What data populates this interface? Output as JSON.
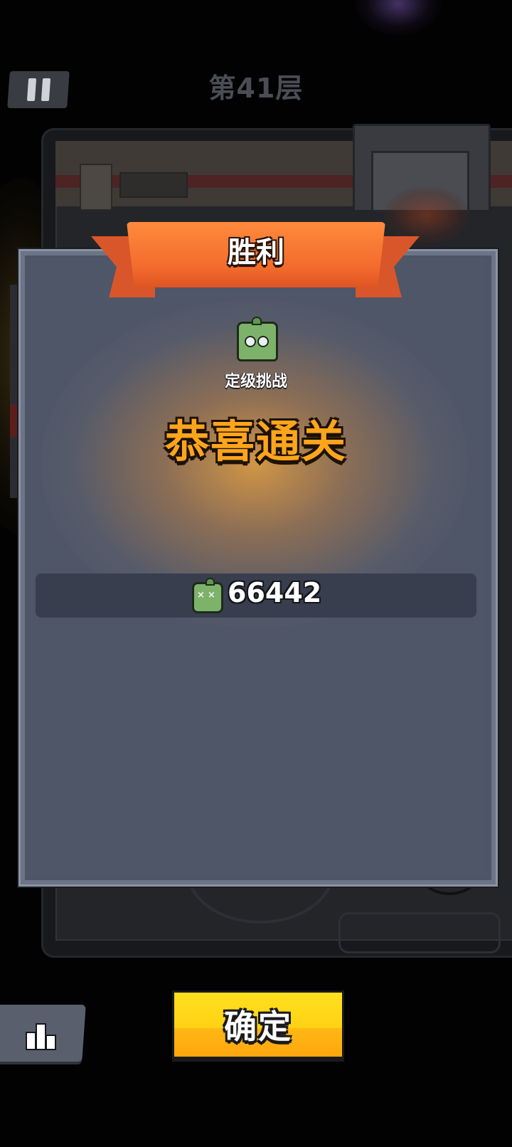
{
  "header": {
    "floor_title": "第41层"
  },
  "result": {
    "ribbon_title": "胜利",
    "challenge_label": "定级挑战",
    "congrats_text": "恭喜通关",
    "reward_value": "66442"
  },
  "footer": {
    "confirm_label": "确定"
  },
  "icons": {
    "pause": "pause-icon",
    "stats": "bar-chart-icon",
    "challenge": "green-zombie-icon",
    "reward": "zombie-kill-icon"
  },
  "colors": {
    "ribbon": "#f26b2c",
    "congrats_text": "#ffa51c",
    "confirm_button": "#ffd214",
    "modal_background": "#4e5668"
  }
}
